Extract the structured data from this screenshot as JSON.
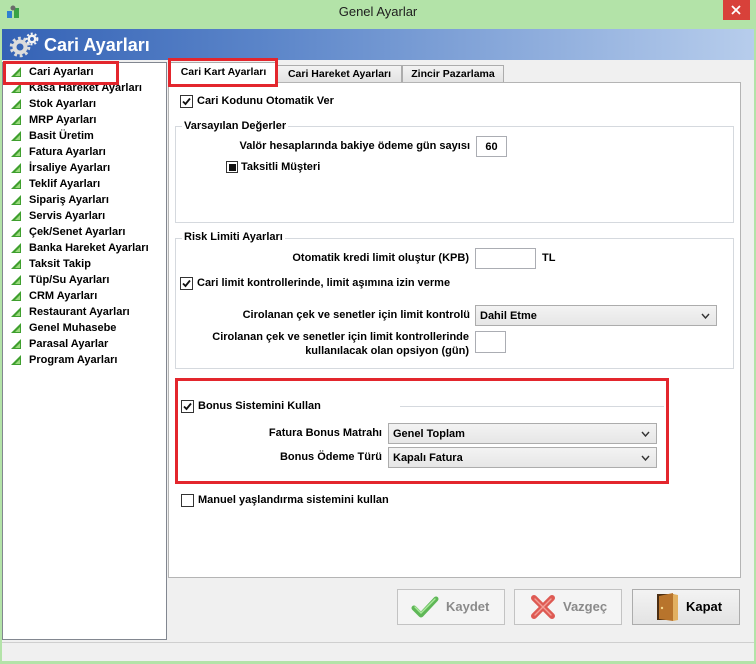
{
  "window": {
    "title": "Genel Ayarlar",
    "app_icon": "app-icon",
    "close_icon": "close-icon"
  },
  "header": {
    "title": "Cari Ayarları",
    "icon": "gears-icon"
  },
  "sidebar": {
    "item_icon": "green-triangle-icon",
    "selected_index": 0,
    "items": [
      "Cari Ayarları",
      "Kasa Hareket Ayarları",
      "Stok Ayarları",
      "MRP Ayarları",
      "Basit Üretim",
      "Fatura Ayarları",
      "İrsaliye Ayarları",
      "Teklif Ayarları",
      "Sipariş Ayarları",
      "Servis Ayarları",
      "Çek/Senet Ayarları",
      "Banka Hareket Ayarları",
      "Taksit Takip",
      "Tüp/Su Ayarları",
      "CRM Ayarları",
      "Restaurant Ayarları",
      "Genel Muhasebe",
      "Parasal Ayarlar",
      "Program Ayarları"
    ]
  },
  "tabs": {
    "active_index": 0,
    "items": [
      "Cari Kart Ayarları",
      "Cari Hareket Ayarları",
      "Zincir Pazarlama"
    ]
  },
  "cari_kart": {
    "auto_code": {
      "label": "Cari Kodunu Otomatik Ver",
      "checked": true
    },
    "defaults": {
      "title": "Varsayılan Değerler",
      "valor_label": "Valör hesaplarında bakiye ödeme gün sayısı",
      "valor_value": "60",
      "installment_label": "Taksitli Müşteri",
      "installment_indeterminate": true
    },
    "risk": {
      "title": "Risk Limiti Ayarları",
      "auto_credit_label": "Otomatik kredi limit oluştur (KPB)",
      "auto_credit_value": "",
      "auto_credit_unit": "TL",
      "allow_exceed_label": "Cari limit kontrollerinde, limit aşımına izin verme",
      "allow_exceed_checked": true,
      "endorsed_label": "Cirolanan çek ve senetler için limit kontrolü",
      "endorsed_value": "Dahil Etme",
      "option_label_line1": "Cirolanan çek ve senetler için limit kontrollerinde",
      "option_label_line2": "kullanılacak olan opsiyon (gün)",
      "option_value": ""
    },
    "bonus": {
      "label": "Bonus Sistemini Kullan",
      "checked": true,
      "base_label": "Fatura Bonus Matrahı",
      "base_value": "Genel Toplam",
      "payment_label": "Bonus Ödeme Türü",
      "payment_value": "Kapalı Fatura"
    },
    "aging": {
      "label": "Manuel yaşlandırma sistemini kullan",
      "checked": false
    },
    "dropdown_icon": "chevron-down-icon"
  },
  "buttons": {
    "save": {
      "label": "Kaydet",
      "icon": "checkmark-icon",
      "enabled": false
    },
    "cancel": {
      "label": "Vazgeç",
      "icon": "cancel-icon",
      "enabled": false
    },
    "close": {
      "label": "Kapat",
      "icon": "door-icon",
      "enabled": true
    }
  },
  "colors": {
    "title_bar": "#b3e3a8",
    "header_start": "#3462b5",
    "header_mid": "#5b85c9",
    "header_end": "#b7cdec",
    "close_button": "#d8413a",
    "annotation": "#e3262d",
    "icon_green": "#3f9f2e",
    "icon_green_light": "#9ada7e",
    "disabled_text": "#8a8a8a"
  }
}
